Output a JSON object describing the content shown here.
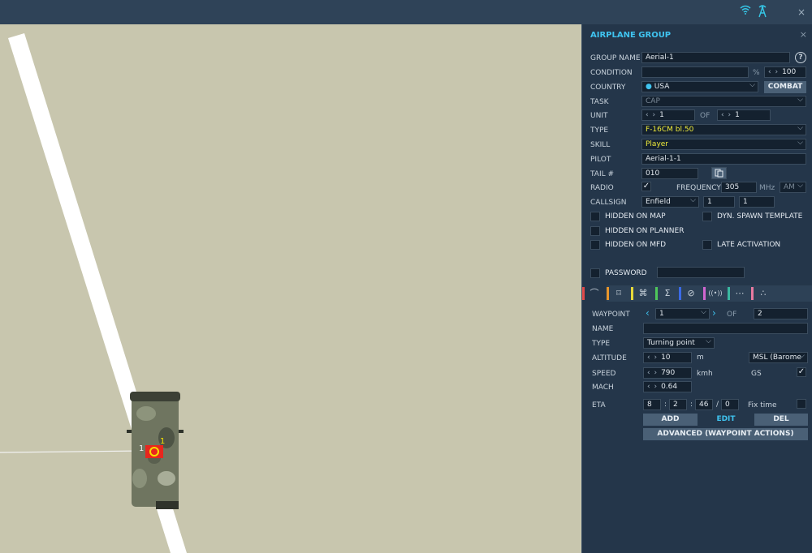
{
  "topbar": {
    "wifi_icon": "wifi-icon",
    "tower_icon": "antenna-icon",
    "close": "×"
  },
  "map": {
    "road_color": "#ffffff",
    "unit_label_a": "1",
    "unit_label_b": "1"
  },
  "panel": {
    "title": "AIRPLANE GROUP",
    "close": "×",
    "group_name": {
      "label": "GROUP NAME",
      "value": "Aerial-1",
      "help": "?"
    },
    "condition": {
      "label": "CONDITION",
      "value": "",
      "unit": "%",
      "percent": "100"
    },
    "country": {
      "label": "COUNTRY",
      "value": "USA",
      "button": "COMBAT"
    },
    "task": {
      "label": "TASK",
      "value": "CAP"
    },
    "unit": {
      "label": "UNIT",
      "value": "1",
      "of_label": "OF",
      "of_value": "1"
    },
    "type": {
      "label": "TYPE",
      "value": "F-16CM bl.50"
    },
    "skill": {
      "label": "SKILL",
      "value": "Player"
    },
    "pilot": {
      "label": "PILOT",
      "value": "Aerial-1-1"
    },
    "tail": {
      "label": "TAIL #",
      "value": "010"
    },
    "radio": {
      "label": "RADIO",
      "checked": "✓",
      "freq_label": "FREQUENCY",
      "freq_value": "305",
      "freq_unit": "MHz",
      "modulation": "AM"
    },
    "callsign": {
      "label": "CALLSIGN",
      "name": "Enfield",
      "num1": "1",
      "num2": "1"
    },
    "checks": {
      "hidden_map": "HIDDEN ON MAP",
      "dyn_spawn": "DYN. SPAWN TEMPLATE",
      "hidden_planner": "HIDDEN ON PLANNER",
      "hidden_mfd": "HIDDEN ON MFD",
      "late_activation": "LATE ACTIVATION",
      "password": "PASSWORD"
    },
    "tab_icons": [
      "route-icon",
      "target-icon",
      "drone-icon",
      "sigma-icon",
      "prohibited-icon",
      "radio-icon",
      "more-icon",
      "formation-icon"
    ],
    "tab_glyphs": [
      "⌒",
      "⌑",
      "⌘",
      "Σ",
      "⊘",
      "((•))",
      "⋯",
      "∴"
    ],
    "tab_colors": [
      "#e04a4a",
      "#e8962c",
      "#e6d83a",
      "#4ec65a",
      "#3a6ae6",
      "#d066d0",
      "#3ab8a0",
      "#e87aa0"
    ],
    "waypoint": {
      "label": "WAYPOINT",
      "value": "1",
      "of_label": "OF",
      "of_value": "2",
      "name_label": "NAME",
      "name_value": "",
      "type_label": "TYPE",
      "type_value": "Turning point",
      "altitude_label": "ALTITUDE",
      "altitude_value": "10",
      "altitude_unit": "m",
      "altitude_ref": "MSL (Barome",
      "speed_label": "SPEED",
      "speed_value": "790",
      "speed_unit": "kmh",
      "gs_label": "GS",
      "gs_checked": "✓",
      "mach_label": "MACH",
      "mach_value": "0.64",
      "eta_label": "ETA",
      "eta_d": "8",
      "eta_h": "2",
      "eta_m": "46",
      "eta_s": "0",
      "sep1": ":",
      "sep2": ":",
      "sep3": "/",
      "fix_time_label": "Fix time",
      "add": "ADD",
      "edit": "EDIT",
      "del": "DEL",
      "advanced": "ADVANCED (WAYPOINT ACTIONS)"
    }
  }
}
